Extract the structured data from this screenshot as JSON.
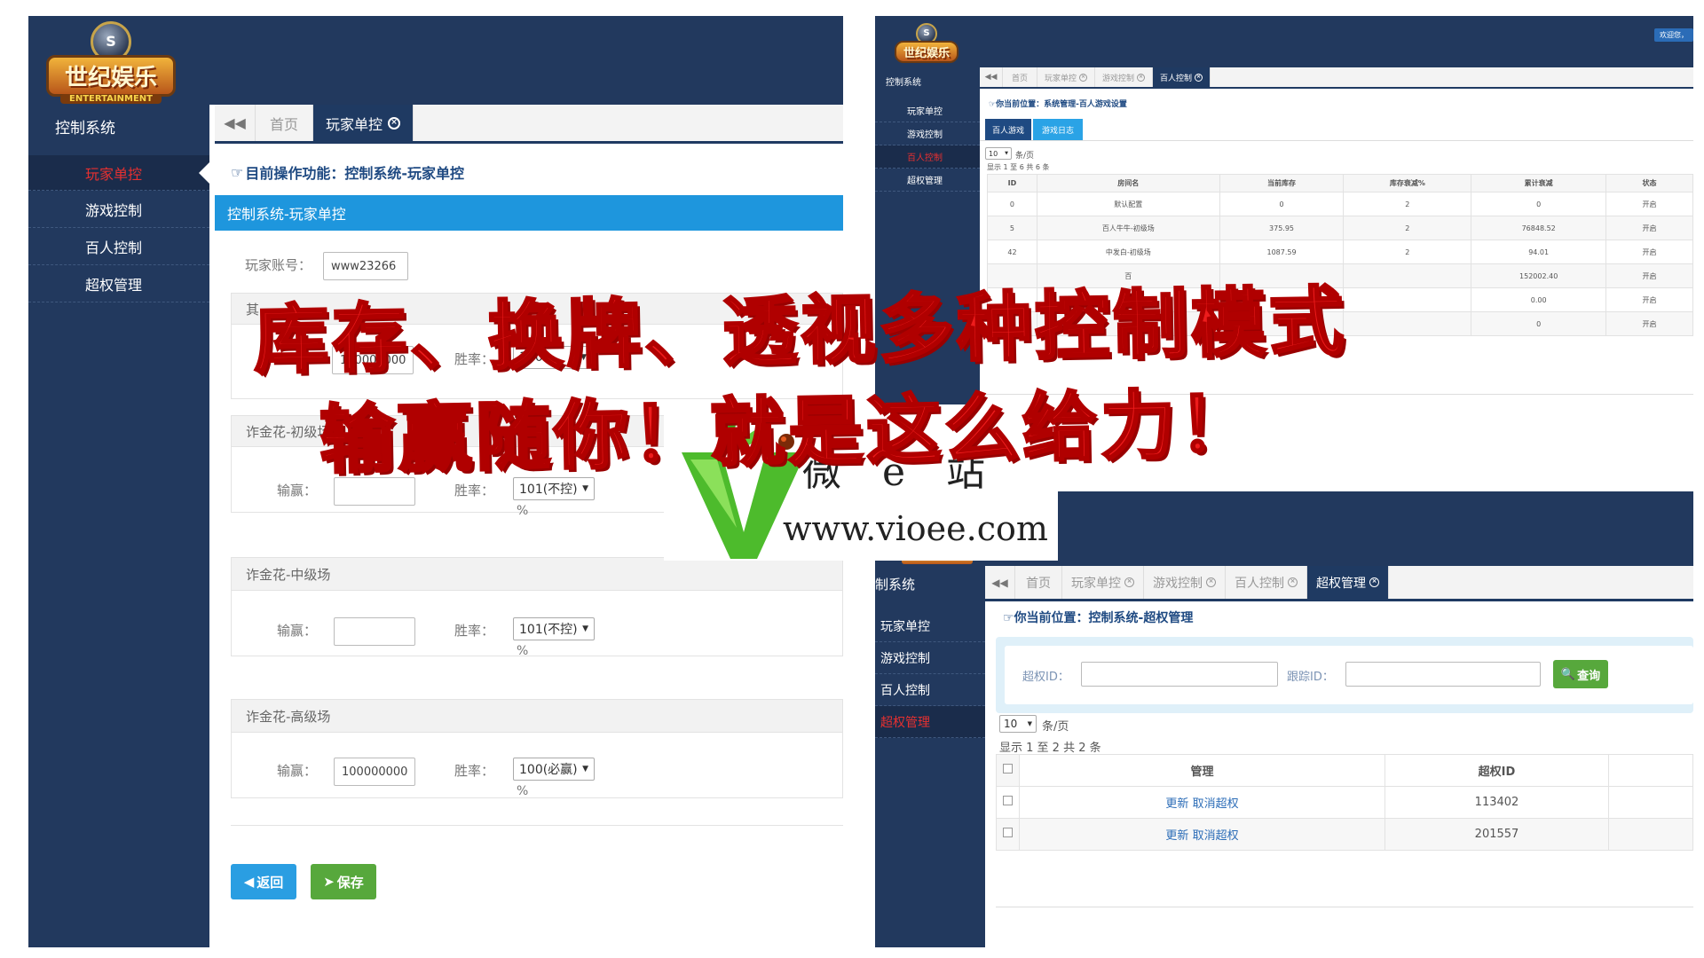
{
  "brand": {
    "title": "世纪娱乐",
    "sub": "ENTERTAINMENT",
    "emblem": "S"
  },
  "left": {
    "sidebar_title": "控制系统",
    "nav": [
      {
        "label": "玩家单控",
        "active": true
      },
      {
        "label": "游戏控制"
      },
      {
        "label": "百人控制"
      },
      {
        "label": "超权管理"
      }
    ],
    "tabs": {
      "home": "首页",
      "active": "玩家单控"
    },
    "crumb": "目前操作功能：控制系统-玩家单控",
    "panel_title": "控制系统-玩家单控",
    "account_label": "玩家账号：",
    "account_value": "www23266",
    "sections": [
      {
        "title": "其",
        "win_label": "输赢：",
        "win_value": "100000000",
        "rate_label": "胜率：",
        "rate_value": "100"
      },
      {
        "title": "诈金花-初级场",
        "win_label": "输赢：",
        "win_value": "",
        "rate_label": "胜率：",
        "rate_value": "101(不控)",
        "unit": "%"
      },
      {
        "title": "诈金花-中级场",
        "win_label": "输赢：",
        "win_value": "",
        "rate_label": "胜率：",
        "rate_value": "101(不控)",
        "unit": "%"
      },
      {
        "title": "诈金花-高级场",
        "win_label": "输赢：",
        "win_value": "100000000",
        "rate_label": "胜率：",
        "rate_value": "100(必赢)",
        "unit": "%"
      }
    ],
    "btn_back": "返回",
    "btn_save": "保存"
  },
  "rt": {
    "sidebar_title": "控制系统",
    "nav": [
      {
        "label": "玩家单控"
      },
      {
        "label": "游戏控制"
      },
      {
        "label": "百人控制",
        "active": true
      },
      {
        "label": "超权管理"
      }
    ],
    "tabs": [
      "首页",
      "玩家单控",
      "游戏控制",
      "百人控制"
    ],
    "welcome": "欢迎您，",
    "crumb": "你当前位置：系统管理-百人游戏设置",
    "subtabs": [
      "百人游戏",
      "游戏日志"
    ],
    "page_size": "10",
    "page_size_unit": "条/页",
    "info": "显示 1 至 6 共 6 条",
    "columns": [
      "ID",
      "房间名",
      "当前库存",
      "库存衰减%",
      "累计衰减",
      "状态"
    ],
    "rows": [
      [
        "0",
        "默认配置",
        "0",
        "2",
        "0",
        "开启"
      ],
      [
        "5",
        "百人牛牛-初级场",
        "375.95",
        "2",
        "76848.52",
        "开启"
      ],
      [
        "42",
        "中发白-初级场",
        "1087.59",
        "2",
        "94.01",
        "开启"
      ],
      [
        "",
        "百",
        "",
        "",
        "152002.40",
        "开启"
      ],
      [
        "",
        "",
        "",
        "",
        "0.00",
        "开启"
      ],
      [
        "",
        "",
        "",
        "",
        "0",
        "开启"
      ]
    ]
  },
  "rb": {
    "sidebar_title": "制系统",
    "nav": [
      {
        "label": "玩家单控"
      },
      {
        "label": "游戏控制"
      },
      {
        "label": "百人控制"
      },
      {
        "label": "超权管理",
        "active": true
      }
    ],
    "tabs": [
      "首页",
      "玩家单控",
      "游戏控制",
      "百人控制",
      "超权管理"
    ],
    "crumb": "你当前位置：控制系统-超权管理",
    "id_label": "超权ID：",
    "track_label": "跟踪ID：",
    "search_btn": "查询",
    "page_size": "10",
    "page_size_unit": "条/页",
    "info": "显示 1 至 2 共 2 条",
    "columns": [
      "管理",
      "超权ID"
    ],
    "rows": [
      {
        "update": "更新",
        "cancel": "取消超权",
        "id": "113402"
      },
      {
        "update": "更新",
        "cancel": "取消超权",
        "id": "201557"
      }
    ]
  },
  "overlay": {
    "line1": "库存、换牌、透视多种控制模式",
    "line2": "输赢随你！就是这么给力！"
  },
  "watermark": {
    "chars": "微 e 站",
    "url": "www.vioee.com"
  },
  "colors": {
    "nav_bg": "#22395e",
    "accent_blue": "#1e96dd",
    "save_green": "#57a83c",
    "headline_red": "#ee1c1c"
  }
}
